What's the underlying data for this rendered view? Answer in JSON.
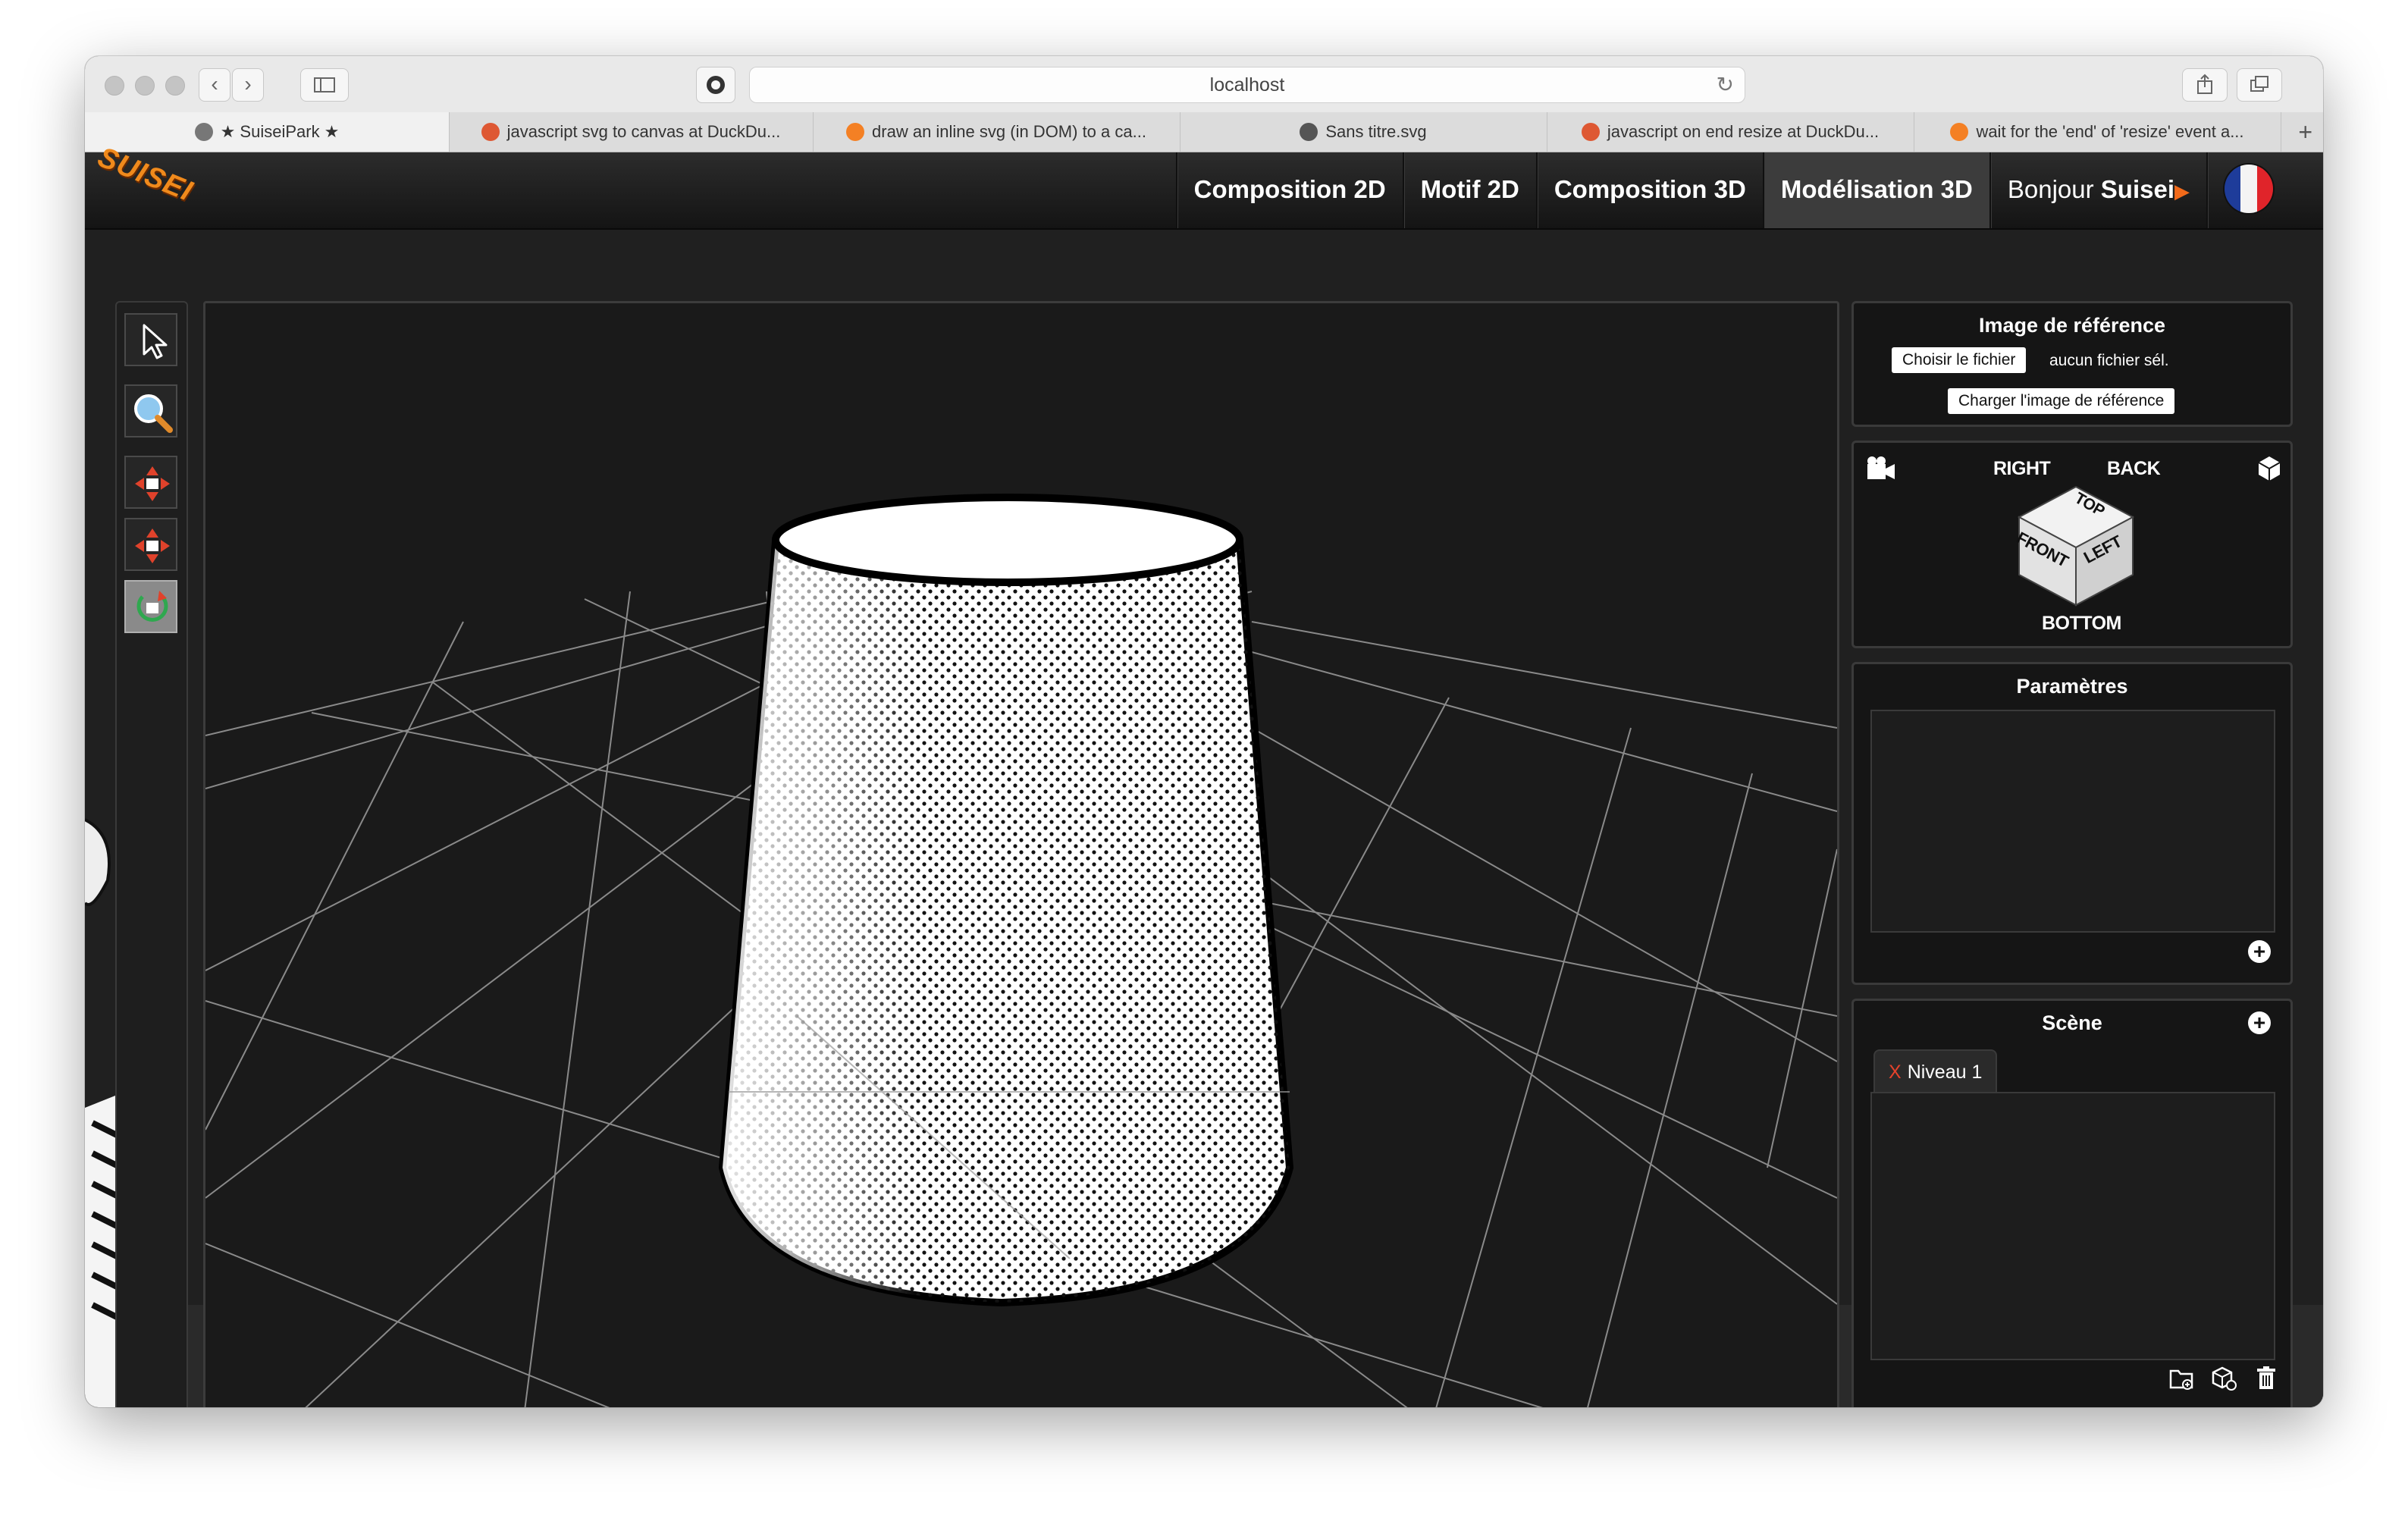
{
  "browser": {
    "url": "localhost",
    "tabs": [
      {
        "title": "★ SuiseiPark ★",
        "favicon_color": "#777777",
        "active": true
      },
      {
        "title": "javascript svg to canvas at DuckDu...",
        "favicon_color": "#de5833",
        "active": false
      },
      {
        "title": "draw an inline svg (in DOM) to a ca...",
        "favicon_color": "#f48024",
        "active": false
      },
      {
        "title": "Sans titre.svg",
        "favicon_color": "#555555",
        "active": false
      },
      {
        "title": "javascript on end resize at DuckDu...",
        "favicon_color": "#de5833",
        "active": false
      },
      {
        "title": "wait for the 'end' of 'resize' event a...",
        "favicon_color": "#f48024",
        "active": false
      }
    ],
    "new_tab_symbol": "+"
  },
  "app": {
    "logo": "SUISEI",
    "menu": [
      {
        "label": "Composition 2D",
        "active": false
      },
      {
        "label": "Motif 2D",
        "active": false
      },
      {
        "label": "Composition 3D",
        "active": false
      },
      {
        "label": "Modélisation 3D",
        "active": true
      }
    ],
    "greeting": "Bonjour",
    "user_name": "Suisei",
    "user_arrow": "▶",
    "accent_color": "#f26a1a"
  },
  "tools": [
    {
      "name": "select-tool",
      "icon": "pointer-arrow-icon",
      "active": false
    },
    {
      "name": "zoom-tool",
      "icon": "magnifier-icon",
      "active": false
    },
    {
      "name": "move-camera-tool",
      "icon": "move-arrows-camera-icon",
      "active": false
    },
    {
      "name": "pan-camera-tool",
      "icon": "pan-arrows-camera-icon",
      "active": false
    },
    {
      "name": "rotate-camera-tool",
      "icon": "rotate-camera-icon",
      "active": true
    }
  ],
  "reference_panel": {
    "title": "Image de référence",
    "choose_file": "Choisir le fichier",
    "no_file": "aucun fichier sél.",
    "load_button": "Charger l'image de référence"
  },
  "view_cube": {
    "right": "RIGHT",
    "back": "BACK",
    "top": "TOP",
    "front": "FRONT",
    "left": "LEFT",
    "bottom": "BOTTOM"
  },
  "params_panel": {
    "title": "Paramètres"
  },
  "scene_panel": {
    "title": "Scène",
    "tab_close": "X",
    "tab_label": "Niveau 1"
  }
}
